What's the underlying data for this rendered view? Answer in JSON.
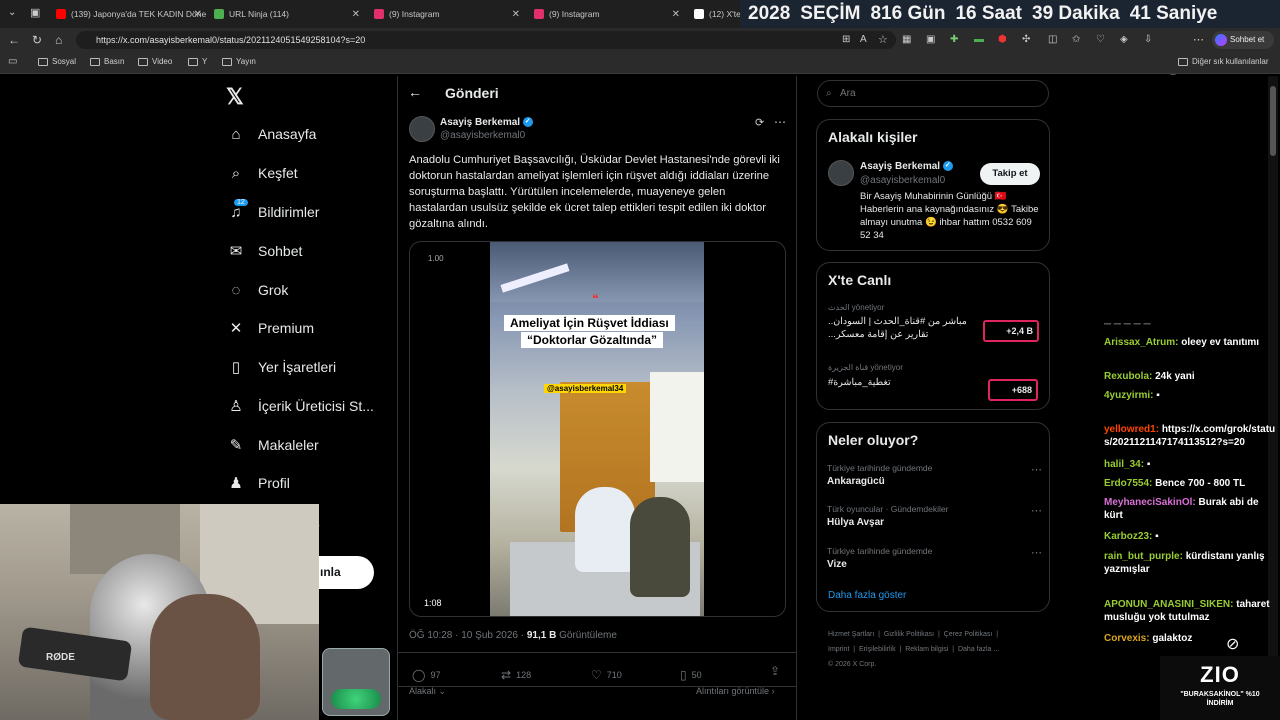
{
  "browser": {
    "tabs": [
      {
        "title": "(139) Japonya'da TEK KADIN Döne",
        "color": "#ff0000"
      },
      {
        "title": "URL Ninja (114)",
        "color": "#4caf50"
      },
      {
        "title": "(9) Instagram",
        "color": "#e1306c"
      },
      {
        "title": "(9) Instagram",
        "color": "#e1306c"
      },
      {
        "title": "(12) X'te",
        "color": "#ffffff"
      }
    ],
    "countdown": {
      "year": "2028",
      "label": "SEÇİM",
      "days": "816 Gün",
      "hours": "16 Saat",
      "minutes": "39 Dakika",
      "seconds": "41 Saniye"
    },
    "url": "https://x.com/asayisberkemal0/status/2021124051549258104?s=20",
    "chat_button": "Sohbet et",
    "bookmarks": [
      "Sosyal",
      "Basın",
      "Video",
      "Y",
      "Yayın"
    ],
    "other_bookmarks": "Diğer sık kullanılanlar"
  },
  "x_nav": {
    "items": [
      {
        "label": "Anasayfa",
        "icon": "home-icon",
        "glyph": "⌂"
      },
      {
        "label": "Keşfet",
        "icon": "search-icon",
        "glyph": "⌕"
      },
      {
        "label": "Bildirimler",
        "icon": "bell-icon",
        "glyph": "🔔"
      },
      {
        "label": "Sohbet",
        "icon": "mail-icon",
        "glyph": "✉"
      },
      {
        "label": "Grok",
        "icon": "grok-icon",
        "glyph": "◌"
      },
      {
        "label": "Premium",
        "icon": "x-premium-icon",
        "glyph": "✕"
      },
      {
        "label": "Yer İşaretleri",
        "icon": "bookmark-icon",
        "glyph": "▯"
      },
      {
        "label": "İçerik Üreticisi St...",
        "icon": "creator-icon",
        "glyph": "♙"
      },
      {
        "label": "Makaleler",
        "icon": "article-icon",
        "glyph": "✎"
      },
      {
        "label": "Profil",
        "icon": "profile-icon",
        "glyph": "♟"
      }
    ],
    "notif_badge": "12",
    "partial_label": "a",
    "post_button_partial": "ınla"
  },
  "post": {
    "header": "Gönderi",
    "author_name": "Asayiş Berkemal",
    "author_handle": "@asayisberkemal0",
    "text": "Anadolu Cumhuriyet Başsavcılığı, Üsküdar Devlet Hastanesi'nde görevli iki doktorun hastalardan ameliyat işlemleri için rüşvet aldığı iddiaları üzerine soruşturma başlattı. Yürütülen incelemelerde, muayeneye gelen hastalardan usulsüz şekilde ek ücret talep ettikleri tespit edilen iki doktor gözaltına alındı.",
    "video": {
      "speed": "1.00",
      "caption1": "Ameliyat İçin Rüşvet İddiası",
      "caption2": "“Doktorlar Gözaltında”",
      "watermark": "@asayisberkemal34",
      "duration": "1:08"
    },
    "meta_time": "ÖĞ 10:28 · 10 Şub 2026 · ",
    "meta_views": "91,1 B",
    "meta_views_label": " Görüntüleme",
    "stats": {
      "replies": "97",
      "reposts": "128",
      "likes": "710",
      "bookmarks": "50"
    },
    "relevant": "Alakalı",
    "quotes": "Alıntıları görüntüle"
  },
  "sidebar": {
    "search_placeholder": "Ara",
    "related_title": "Alakalı kişiler",
    "related": {
      "name": "Asayiş Berkemal",
      "handle": "@asayisberkemal0",
      "follow": "Takip et",
      "bio": "Bir Asayiş Muhabirinin Günlüğü 🇹🇷 Haberlerin ana kaynağındasınız 😎 Takibe almayı unutma 😉 ihbar hattım 0532 609 52 34"
    },
    "live_title": "X'te Canlı",
    "live": [
      {
        "host": "الحدث",
        "role": "yönetiyor",
        "title": "مباشر من #قناة_الحدث | السودان.. تقارير عن إقامة معسكر...",
        "count": "+2,4 B"
      },
      {
        "host": "قناة الجزيرة",
        "role": "yönetiyor",
        "title": "#تغطية_مباشرة",
        "count": "+688"
      }
    ],
    "trends_title": "Neler oluyor?",
    "trends": [
      {
        "context": "Türkiye tarihinde gündemde",
        "name": "Ankaragücü"
      },
      {
        "context": "Türk oyuncular · Gündemdekiler",
        "name": "Hülya Avşar"
      },
      {
        "context": "Türkiye tarihinde gündemde",
        "name": "Vize"
      }
    ],
    "show_more": "Daha fazla göster",
    "footer": [
      "Hizmet Şartları",
      "Gizlilik Politikası",
      "Çerez Politikası",
      "Imprint",
      "Erişilebilirlik",
      "Reklam bilgisi",
      "Daha fazla ...",
      "© 2026 X Corp."
    ]
  },
  "chat": [
    {
      "user": "",
      "text": "",
      "partial": "...y..."
    },
    {
      "user": "Arissax_Atrum:",
      "text": "oleey ev tanıtımı",
      "color": "#9acd32"
    },
    {
      "user": "Rexubola:",
      "text": "24k yani",
      "color": "#9acd32"
    },
    {
      "user": "4yuzyirmi:",
      "text": "",
      "color": "#9acd32"
    },
    {
      "user": "yellowred1:",
      "text": "https://x.com/grok/status/2021121147174113512?s=20",
      "color": "#ff4500"
    },
    {
      "user": "halil_34:",
      "text": "",
      "color": "#9acd32"
    },
    {
      "user": "Erdo7554:",
      "text": "Bence 700 - 800 TL",
      "color": "#9acd32"
    },
    {
      "user": "MeyhaneciSakinOl:",
      "text": "Burak abi de kürt",
      "color": "#da70d6"
    },
    {
      "user": "Karboz23:",
      "text": "",
      "color": "#9acd32"
    },
    {
      "user": "rain_but_purple:",
      "text": "kürdistanı yanlış yazmışlar",
      "color": "#9acd32"
    },
    {
      "user": "APONUN_ANASINI_SIKEN:",
      "text": "taharet musluğu yok tutulmaz",
      "color": "#9acd32"
    },
    {
      "user": "Corvexis:",
      "text": "galaktoz",
      "color": "#daa520"
    }
  ],
  "stream": {
    "mic_brand": "RØDE",
    "sponsor": "ZIO",
    "promo": "\"BURAKSAKİNOL\" %10 İNDİRİM"
  }
}
